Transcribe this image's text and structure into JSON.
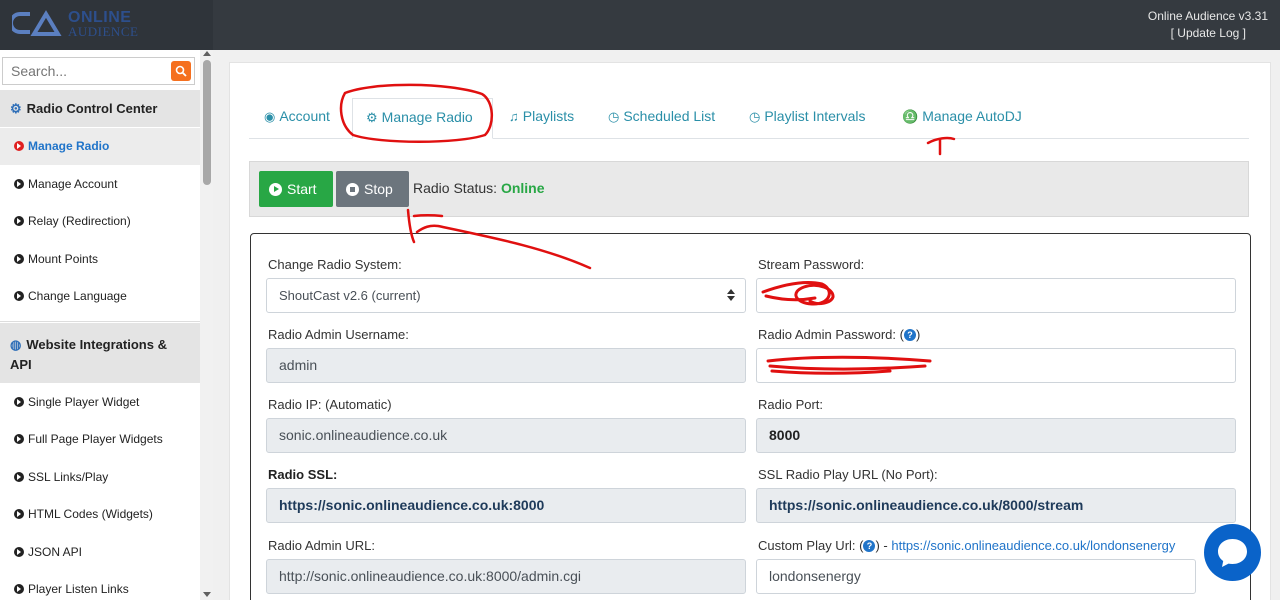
{
  "header": {
    "logo_line1": "ONLINE",
    "logo_line2": "AUDIENCE",
    "app_version": "Online Audience v3.31",
    "update_log": "[ Update Log ]"
  },
  "sidebar": {
    "search_placeholder": "Search...",
    "sections": [
      {
        "title": "Radio Control Center"
      },
      {
        "title": "Website Integrations &",
        "title_line2": "API"
      }
    ],
    "radio_items": [
      "Manage Radio",
      "Manage Account",
      "Relay (Redirection)",
      "Mount Points",
      "Change Language"
    ],
    "web_items": [
      "Single Player Widget",
      "Full Page Player Widgets",
      "SSL Links/Play",
      "HTML Codes (Widgets)",
      "JSON API",
      "Player Listen Links"
    ]
  },
  "tabs": [
    "Account",
    "Manage Radio",
    "Playlists",
    "Scheduled List",
    "Playlist Intervals",
    "Manage AutoDJ"
  ],
  "controls": {
    "start_label": "Start",
    "stop_label": "Stop",
    "status_label": "Radio Status:",
    "status_value": "Online"
  },
  "form": {
    "radio_system_label": "Change Radio System:",
    "radio_system_value": "ShoutCast v2.6 (current)",
    "stream_password_label": "Stream Password:",
    "admin_username_label": "Radio Admin Username:",
    "admin_username_value": "admin",
    "admin_password_label": "Radio Admin Password: (",
    "admin_password_label_end": ")",
    "help_glyph": "?",
    "radio_ip_label": "Radio IP: (Automatic)",
    "radio_ip_value": "sonic.onlineaudience.co.uk",
    "radio_port_label": "Radio Port:",
    "radio_port_value": "8000",
    "radio_ssl_label": "Radio SSL:",
    "radio_ssl_value": "https://sonic.onlineaudience.co.uk:8000",
    "ssl_play_url_label": "SSL Radio Play URL (No Port):",
    "ssl_play_url_value": "https://sonic.onlineaudience.co.uk/8000/stream",
    "admin_url_label": "Radio Admin URL:",
    "admin_url_value": "http://sonic.onlineaudience.co.uk:8000/admin.cgi",
    "custom_play_label": "Custom Play Url: (",
    "custom_play_label_mid": ") - ",
    "custom_play_link": "https://sonic.onlineaudience.co.uk/londonsenergy",
    "custom_play_value": "londonsenergy"
  },
  "colors": {
    "accent": "#2a8fa8",
    "start": "#28a745",
    "stop": "#6c757d",
    "annotation": "#e01010",
    "chat": "#0a63c9"
  }
}
